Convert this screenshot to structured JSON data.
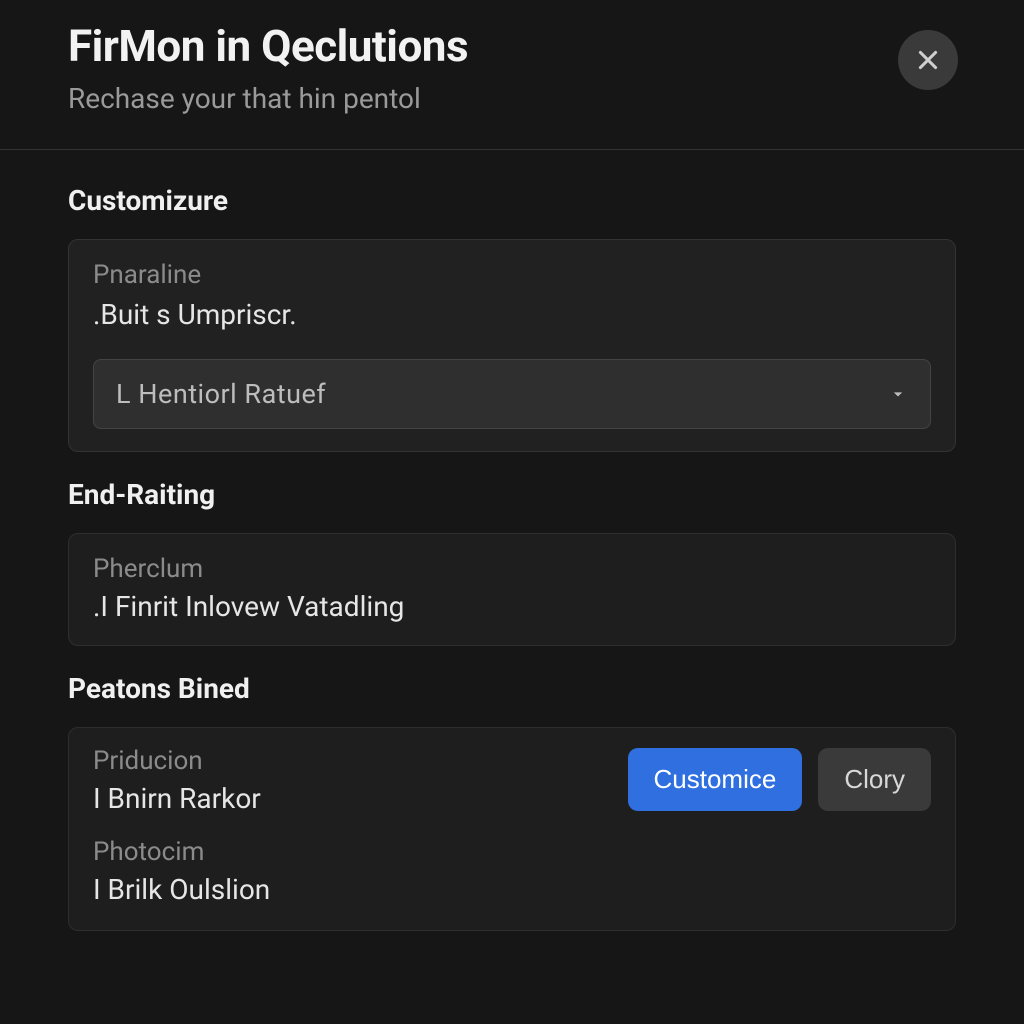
{
  "header": {
    "title": "FirMon in Qeclutions",
    "subtitle": "Rechase your that hin pentol"
  },
  "sections": {
    "customize": {
      "heading": "Customizure",
      "field_label": "Pnaraline",
      "field_value": ".Buit s Umpriscr.",
      "select_value": "L Hentiorl Ratuef"
    },
    "end_rating": {
      "heading": "End-Raiting",
      "field_label": "Pherclum",
      "field_value": ".I Finrit Inlovew Vatadling"
    },
    "peatons": {
      "heading": "Peatons Bined",
      "item1_label": "Priducion",
      "item1_value": "I Bnirn Rarkor",
      "item2_label": "Photocim",
      "item2_value": "I Brilk Oulslion",
      "btn_primary": "Customice",
      "btn_secondary": "Clory"
    }
  }
}
